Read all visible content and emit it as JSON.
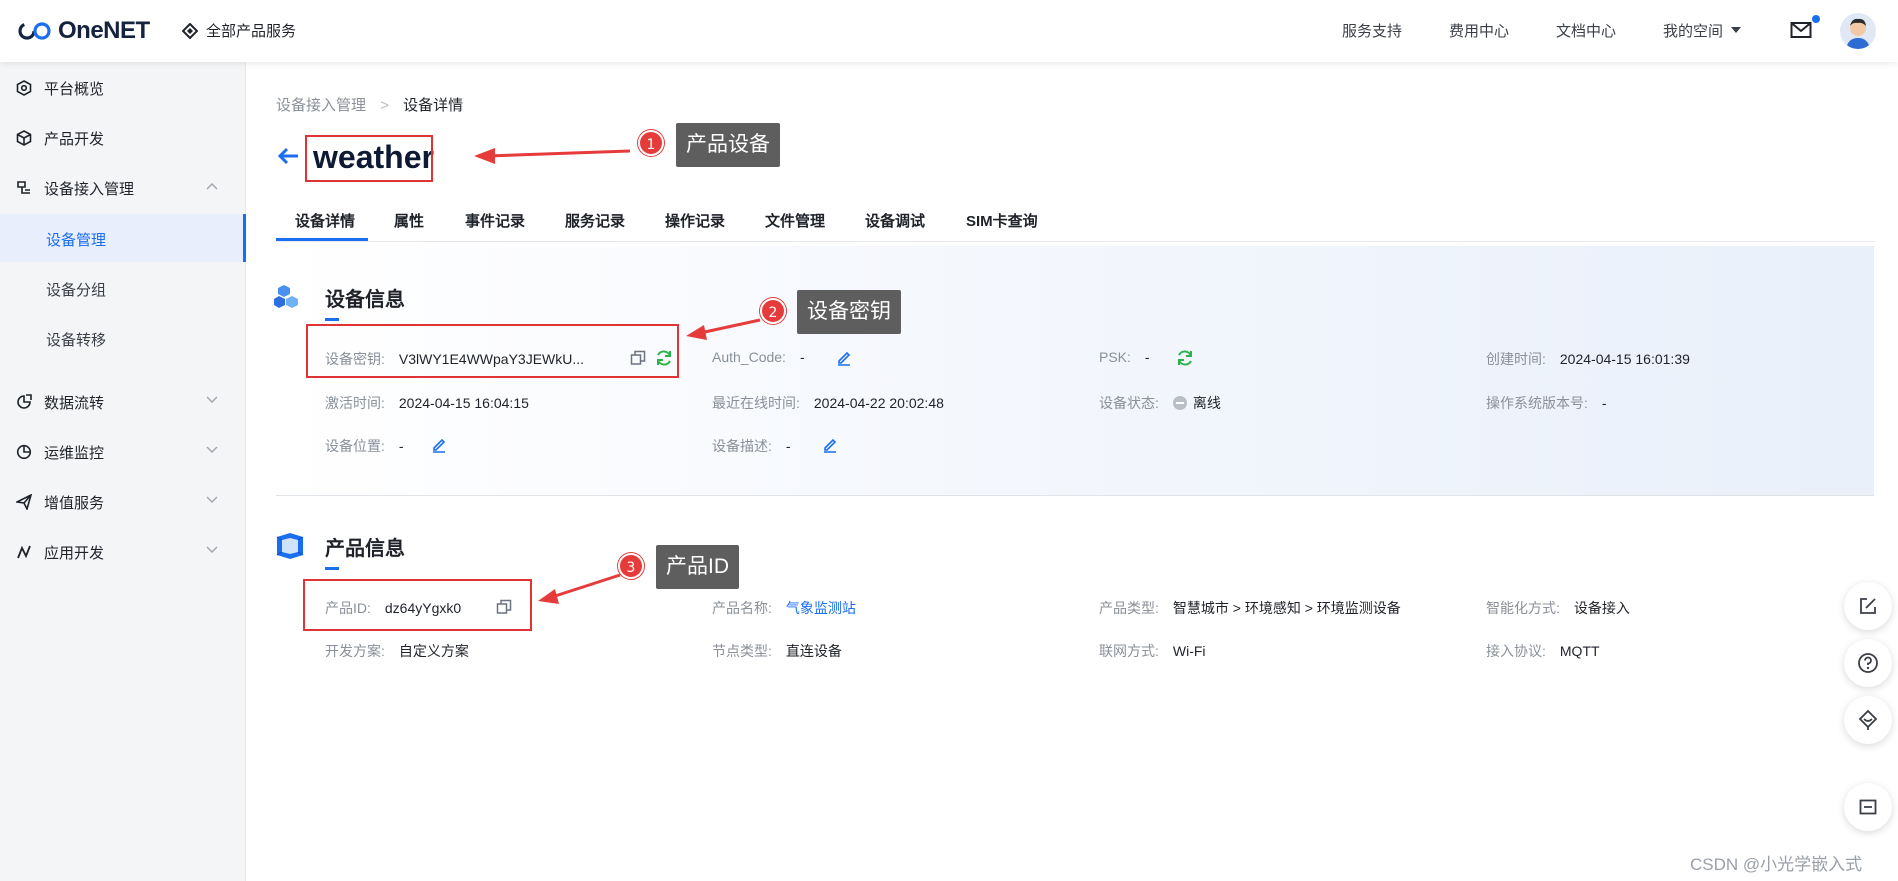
{
  "header": {
    "logo_text": "OneNET",
    "all_products": "全部产品服务",
    "nav": [
      "服务支持",
      "费用中心",
      "文档中心",
      "我的空间"
    ],
    "accent": "#1a6ef0"
  },
  "sidebar": {
    "items": [
      {
        "label": "平台概览",
        "icon": "dashboard-icon"
      },
      {
        "label": "产品开发",
        "icon": "cube-icon"
      },
      {
        "label": "设备接入管理",
        "icon": "device-access-icon",
        "expanded": true,
        "children": [
          "设备管理",
          "设备分组",
          "设备转移"
        ],
        "active_child": "设备管理"
      },
      {
        "label": "数据流转",
        "icon": "data-flow-icon"
      },
      {
        "label": "运维监控",
        "icon": "monitor-icon"
      },
      {
        "label": "增值服务",
        "icon": "send-icon"
      },
      {
        "label": "应用开发",
        "icon": "app-dev-icon"
      }
    ]
  },
  "breadcrumb": {
    "parent": "设备接入管理",
    "sep": ">",
    "current": "设备详情"
  },
  "page": {
    "title": "weather"
  },
  "tabs": [
    "设备详情",
    "属性",
    "事件记录",
    "服务记录",
    "操作记录",
    "文件管理",
    "设备调试",
    "SIM卡查询"
  ],
  "device_info": {
    "title": "设备信息",
    "fields": {
      "device_key": {
        "label": "设备密钥:",
        "value": "V3lWY1E4WWpaY3JEWkU..."
      },
      "auth_code": {
        "label": "Auth_Code:",
        "value": "-"
      },
      "psk": {
        "label": "PSK:",
        "value": "-"
      },
      "created": {
        "label": "创建时间:",
        "value": "2024-04-15 16:01:39"
      },
      "activated": {
        "label": "激活时间:",
        "value": "2024-04-15 16:04:15"
      },
      "last_online": {
        "label": "最近在线时间:",
        "value": "2024-04-22 20:02:48"
      },
      "status": {
        "label": "设备状态:",
        "value": "离线"
      },
      "os_version": {
        "label": "操作系统版本号:",
        "value": "-"
      },
      "location": {
        "label": "设备位置:",
        "value": "-"
      },
      "description": {
        "label": "设备描述:",
        "value": "-"
      }
    }
  },
  "product_info": {
    "title": "产品信息",
    "fields": {
      "product_id": {
        "label": "产品ID:",
        "value": "dz64yYgxk0"
      },
      "product_name": {
        "label": "产品名称:",
        "value": "气象监测站"
      },
      "product_type": {
        "label": "产品类型:",
        "value": "智慧城市 > 环境感知 > 环境监测设备"
      },
      "smart_mode": {
        "label": "智能化方式:",
        "value": "设备接入"
      },
      "dev_plan": {
        "label": "开发方案:",
        "value": "自定义方案"
      },
      "node_type": {
        "label": "节点类型:",
        "value": "直连设备"
      },
      "network": {
        "label": "联网方式:",
        "value": "Wi-Fi"
      },
      "protocol": {
        "label": "接入协议:",
        "value": "MQTT"
      }
    }
  },
  "annotations": [
    {
      "num": "1",
      "label": "产品设备"
    },
    {
      "num": "2",
      "label": "设备密钥"
    },
    {
      "num": "3",
      "label": "产品ID"
    }
  ],
  "watermark": "CSDN @小光学嵌入式"
}
